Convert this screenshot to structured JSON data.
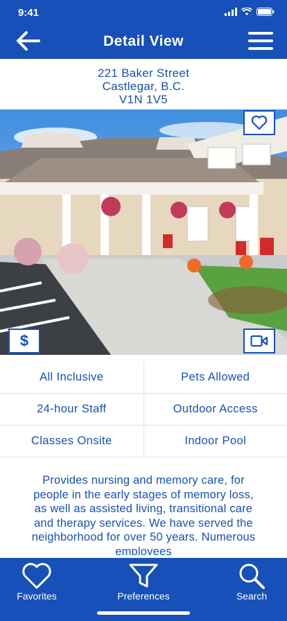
{
  "status": {
    "time": "9:41"
  },
  "header": {
    "title": "Detail View"
  },
  "address": {
    "line1": "221 Baker Street",
    "line2": "Castlegar, B.C.",
    "line3": "V1N 1V5"
  },
  "photo": {
    "price_symbol": "$"
  },
  "features": [
    [
      "All Inclusive",
      "Pets Allowed"
    ],
    [
      "24-hour Staff",
      "Outdoor Access"
    ],
    [
      "Classes Onsite",
      "Indoor Pool"
    ]
  ],
  "description": "Provides nursing and memory care, for people in the early stages of memory loss, as well as assisted living, transitional care and therapy services. We have served the neighborhood for over 50 years.  Numerous employees",
  "tabbar": {
    "favorites": "Favorites",
    "preferences": "Preferences",
    "search": "Search"
  },
  "colors": {
    "brand": "#1650b8",
    "text": "#1a4fa8"
  },
  "icons": [
    "back-arrow-icon",
    "menu-icon",
    "heart-icon",
    "dollar-icon",
    "video-icon",
    "filter-icon",
    "search-icon"
  ]
}
